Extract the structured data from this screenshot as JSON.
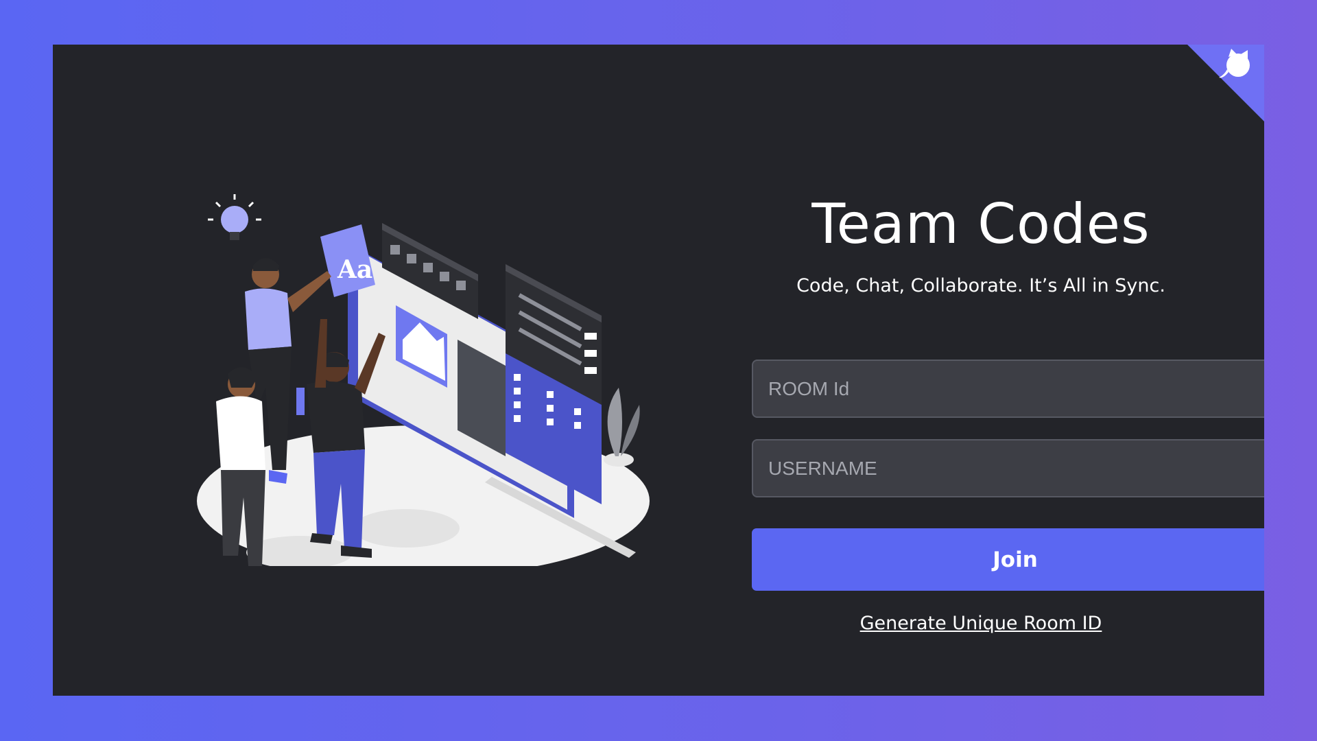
{
  "app": {
    "title": "Team Codes",
    "tagline": "Code, Chat, Collaborate. It’s All in Sync."
  },
  "form": {
    "room_id_placeholder": "ROOM Id",
    "room_id_value": "",
    "username_placeholder": "USERNAME",
    "username_value": "",
    "join_label": "Join",
    "generate_label": "Generate Unique Room ID"
  },
  "corner": {
    "icon": "github-cat-icon"
  },
  "illustration": {
    "icon": "team-collaboration-illustration",
    "badge": "Aa"
  },
  "colors": {
    "background_gradient_start": "#5a66f3",
    "background_gradient_end": "#7a5fe3",
    "card_background": "#232429",
    "input_background": "#3d3e45",
    "accent": "#5b67f2"
  }
}
